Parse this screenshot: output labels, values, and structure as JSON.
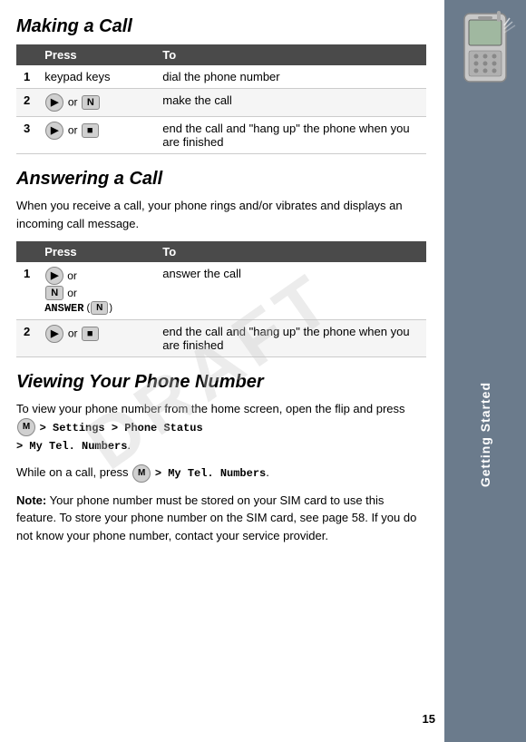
{
  "page": {
    "draft_watermark": "DRAFT",
    "page_number": "15"
  },
  "sidebar": {
    "label": "Getting Started"
  },
  "sections": {
    "making_a_call": {
      "title": "Making a Call",
      "table": {
        "col_press": "Press",
        "col_to": "To",
        "rows": [
          {
            "num": "1",
            "press": "keypad keys",
            "to": "dial the phone number"
          },
          {
            "num": "2",
            "press": "send_or_N",
            "to": "make the call"
          },
          {
            "num": "3",
            "press": "send_or_end",
            "to": "end the call and “hang up” the phone when you are finished"
          }
        ]
      }
    },
    "answering_a_call": {
      "title": "Answering a Call",
      "body": "When you receive a call, your phone rings and/or vibrates and displays an incoming call message.",
      "table": {
        "col_press": "Press",
        "col_to": "To",
        "rows": [
          {
            "num": "1",
            "press": "send_or_N_or_ANSWER",
            "to": "answer the call"
          },
          {
            "num": "2",
            "press": "send_or_end",
            "to": "end the call and “hang up” the phone when you are finished"
          }
        ]
      }
    },
    "viewing_phone_number": {
      "title": "Viewing Your Phone Number",
      "para1_before": "To view your phone number from the home screen, open the flip and press",
      "para1_menu": "M > Settings > Phone Status > My Tel. Numbers",
      "para1_after": ".",
      "para2_before": "While on a call, press",
      "para2_menu": "M > My Tel. Numbers",
      "para2_after": ".",
      "note_label": "Note:",
      "note_text": " Your phone number must be stored on your SIM card to use this feature. To store your phone number on the SIM card, see page 58. If you do not know your phone number, contact your service provider."
    }
  }
}
